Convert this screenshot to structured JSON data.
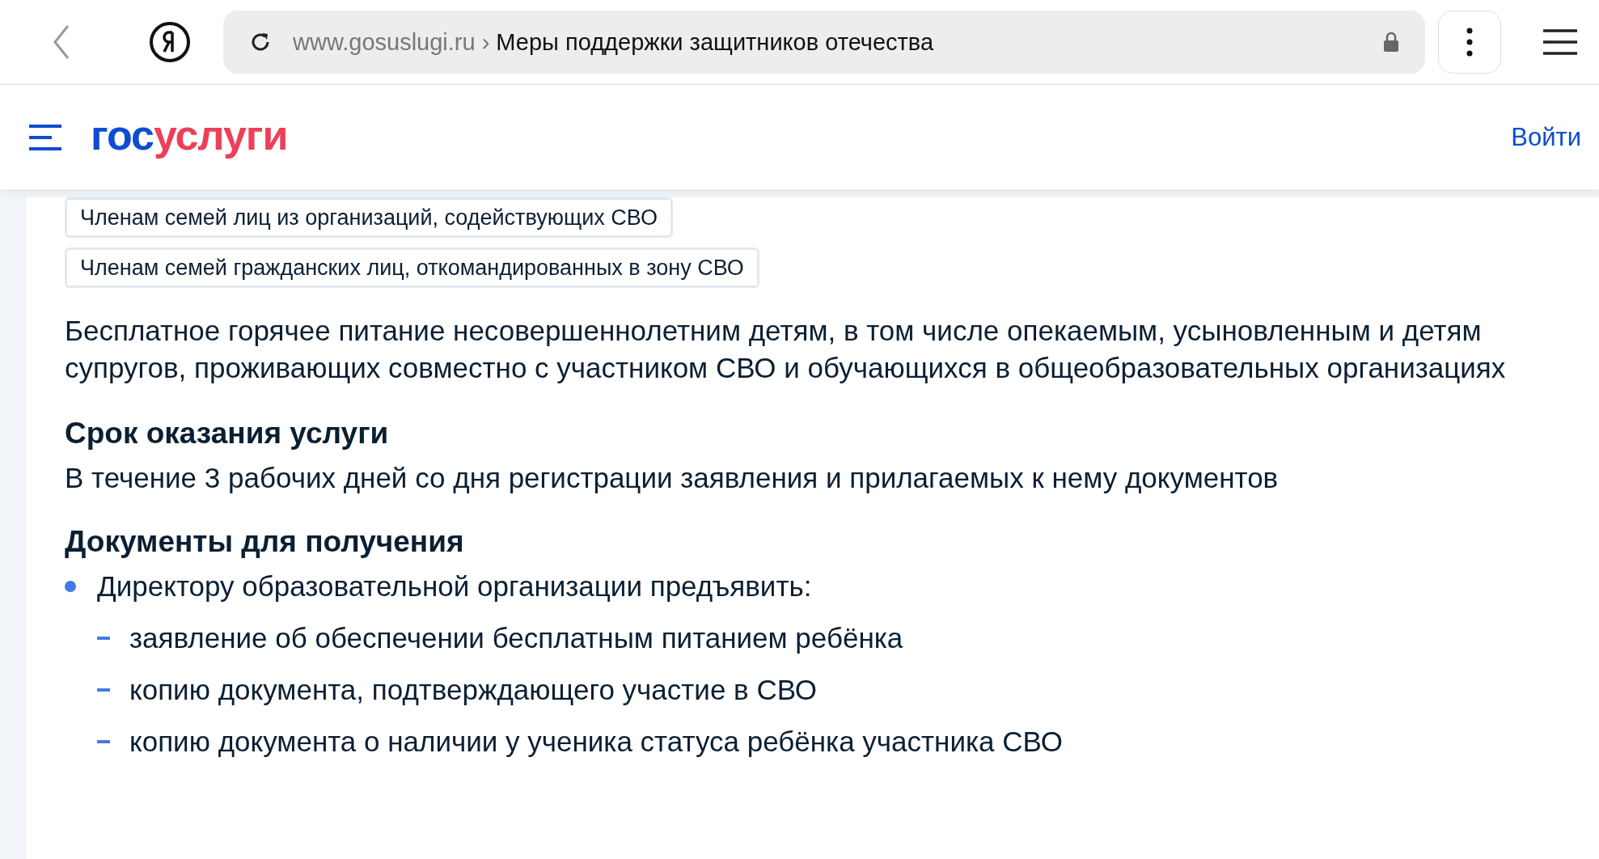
{
  "browser": {
    "domain": "www.gosuslugi.ru",
    "separator": "›",
    "page_title": "Меры поддержки защитников отечества"
  },
  "header": {
    "logo_primary": "гос",
    "logo_accent": "услуги",
    "login": "Войти"
  },
  "tags": [
    {
      "label": "Членам семей лиц из организаций, содействующих СВО"
    },
    {
      "label": "Членам семей гражданских лиц, откомандированных в зону СВО"
    }
  ],
  "description": "Бесплатное горячее питание несовершеннолетним детям, в том числе опекаемым, усыновленным и детям супругов, проживающих совместно с участником СВО и обучающихся в общеобразовательных организациях",
  "term": {
    "heading": "Срок оказания услуги",
    "text": "В течение 3 рабочих дней со дня регистрации заявления и прилагаемых к нему документов"
  },
  "documents": {
    "heading": "Документы для получения",
    "items": [
      {
        "text": "Директору образовательной организации предъявить:",
        "children": [
          {
            "text": "заявление об обеспечении бесплатным питанием ребёнка"
          },
          {
            "text": "копию документа, подтверждающего участие в СВО"
          },
          {
            "text": "копию документа о наличии у ученика статуса ребёнка участника СВО"
          }
        ]
      }
    ]
  }
}
